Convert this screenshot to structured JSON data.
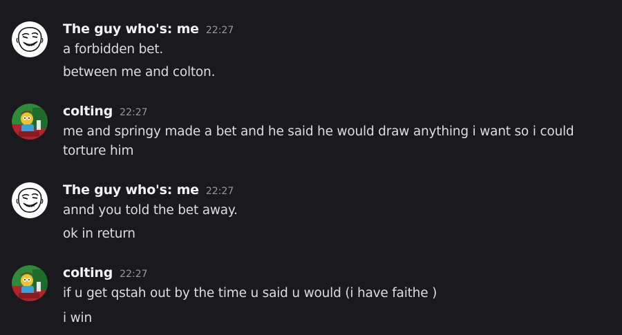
{
  "messages": [
    {
      "author": "The guy who's: me",
      "time": "22:27",
      "avatar_icon": "troll-face-avatar-icon",
      "lines": [
        "a forbidden bet.",
        "between me and colton."
      ]
    },
    {
      "author": "colting",
      "time": "22:27",
      "avatar_icon": "cartoon-character-avatar-icon",
      "lines": [
        "me and springy made a bet and he said he would draw anything i want so i could torture him"
      ]
    },
    {
      "author": "The guy who's: me",
      "time": "22:27",
      "avatar_icon": "troll-face-avatar-icon",
      "lines": [
        "annd you told the bet away.",
        "ok in return"
      ]
    },
    {
      "author": "colting",
      "time": "22:27",
      "avatar_icon": "cartoon-character-avatar-icon",
      "lines": [
        "if u get qstah out by the time u said u would (i have faithe )",
        "i win"
      ]
    }
  ],
  "colors": {
    "background": "#1a1a1e",
    "username": "#f2f3f5",
    "timestamp": "#949ba4",
    "message_text": "#dbdee1"
  }
}
